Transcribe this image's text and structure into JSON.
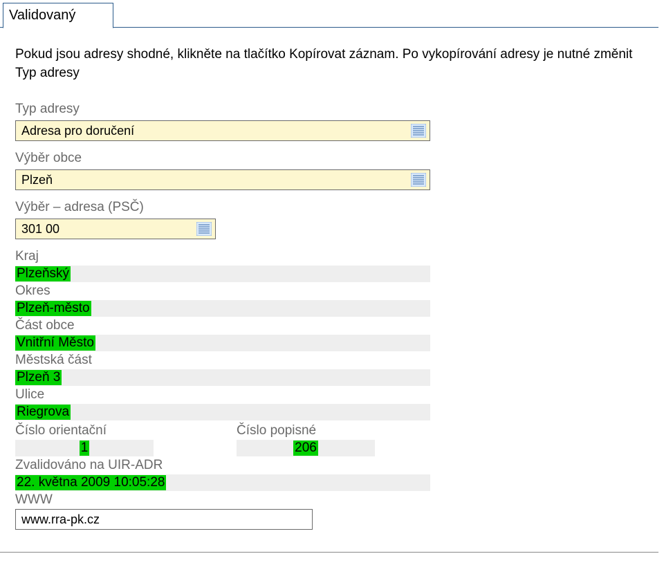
{
  "tab": {
    "label": "Validovaný"
  },
  "description": "Pokud jsou adresy shodné, klikněte na tlačítko Kopírovat záznam. Po vykopírování adresy je nutné změnit Typ adresy",
  "fields": {
    "typ_adresy": {
      "label": "Typ adresy",
      "value": "Adresa pro doručení"
    },
    "vyber_obce": {
      "label": "Výběr obce",
      "value": "Plzeň"
    },
    "vyber_psc": {
      "label": "Výběr – adresa (PSČ)",
      "value": "301 00"
    },
    "kraj": {
      "label": "Kraj",
      "value": "Plzeňský"
    },
    "okres": {
      "label": "Okres",
      "value": "Plzeň-město"
    },
    "cast_obce": {
      "label": "Část obce",
      "value": "Vnitřní Město"
    },
    "mestska_cast": {
      "label": "Městská část",
      "value": "Plzeň 3"
    },
    "ulice": {
      "label": "Ulice",
      "value": "Riegrova"
    },
    "cislo_or": {
      "label": "Číslo orientační",
      "value": "1"
    },
    "cislo_pop": {
      "label": "Číslo popisné",
      "value": "206"
    },
    "validated": {
      "label": "Zvalidováno na UIR-ADR",
      "value": "22. května 2009  10:05:28"
    },
    "www": {
      "label": "WWW",
      "value": "www.rra-pk.cz"
    }
  }
}
